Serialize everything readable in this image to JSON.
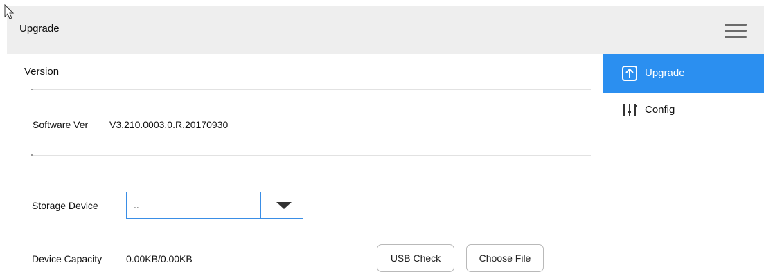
{
  "header": {
    "title": "Upgrade",
    "menu_icon": "hamburger-menu-icon"
  },
  "sidebar": {
    "items": [
      {
        "label": "Upgrade",
        "icon": "upgrade-arrow-icon",
        "active": true
      },
      {
        "label": "Config",
        "icon": "sliders-icon",
        "active": false
      }
    ]
  },
  "version_section": {
    "title": "Version",
    "software_label": "Software Ver",
    "software_value": "V3.210.0003.0.R.20170930"
  },
  "storage": {
    "label": "Storage Device",
    "selected": ".."
  },
  "capacity": {
    "label": "Device Capacity",
    "value": "0.00KB/0.00KB"
  },
  "buttons": {
    "usb_check": "USB Check",
    "choose_file": "Choose File"
  },
  "colors": {
    "accent": "#2b8ff0",
    "topbar": "#eeeeee",
    "select_border": "#3a8ee6"
  }
}
